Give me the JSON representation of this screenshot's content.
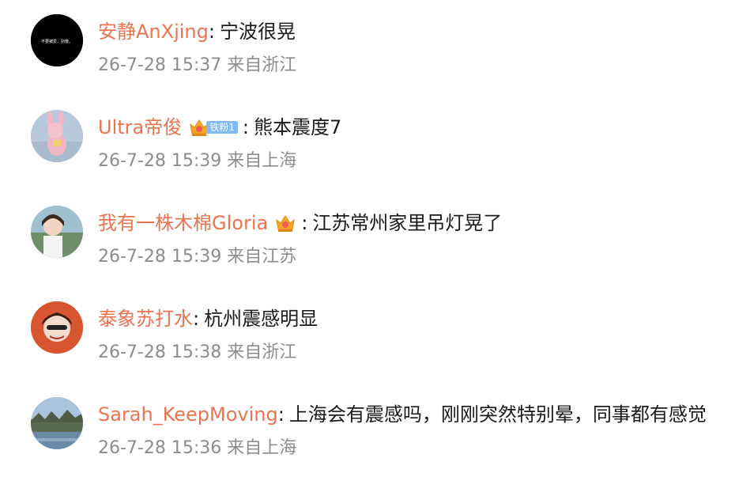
{
  "comments": [
    {
      "username": "安静AnXjing",
      "separator": ":",
      "text": "宁波很晃",
      "timestamp": "26-7-28 15:37",
      "location": "来自浙江",
      "avatar_text": "不要被爱，别傻。",
      "avatar_bg": "#000000"
    },
    {
      "username": "Ultra帝俊",
      "separator": ":",
      "text": "熊本震度7",
      "timestamp": "26-7-28 15:39",
      "location": "来自上海",
      "fan_badge_label": "铁粉1",
      "badge_icon": "crown-icon"
    },
    {
      "username": "我有一株木棉Gloria",
      "separator": ":",
      "text": "江苏常州家里吊灯晃了",
      "timestamp": "26-7-28 15:39",
      "location": "来自江苏",
      "badge_icon": "crown-icon"
    },
    {
      "username": "泰象苏打水",
      "separator": ":",
      "text": "杭州震感明显",
      "timestamp": "26-7-28 15:38",
      "location": "来自浙江"
    },
    {
      "username": "Sarah_KeepMoving",
      "separator": ":",
      "text": "上海会有震感吗，刚刚突然特别晕，同事都有感觉",
      "timestamp": "26-7-28 15:36",
      "location": "来自上海"
    }
  ],
  "colors": {
    "username": "#eb7350",
    "text": "#1a1a1a",
    "meta": "#8c8c8c",
    "fan_badge": "#7fbaf5",
    "crown": "#f5a623"
  }
}
